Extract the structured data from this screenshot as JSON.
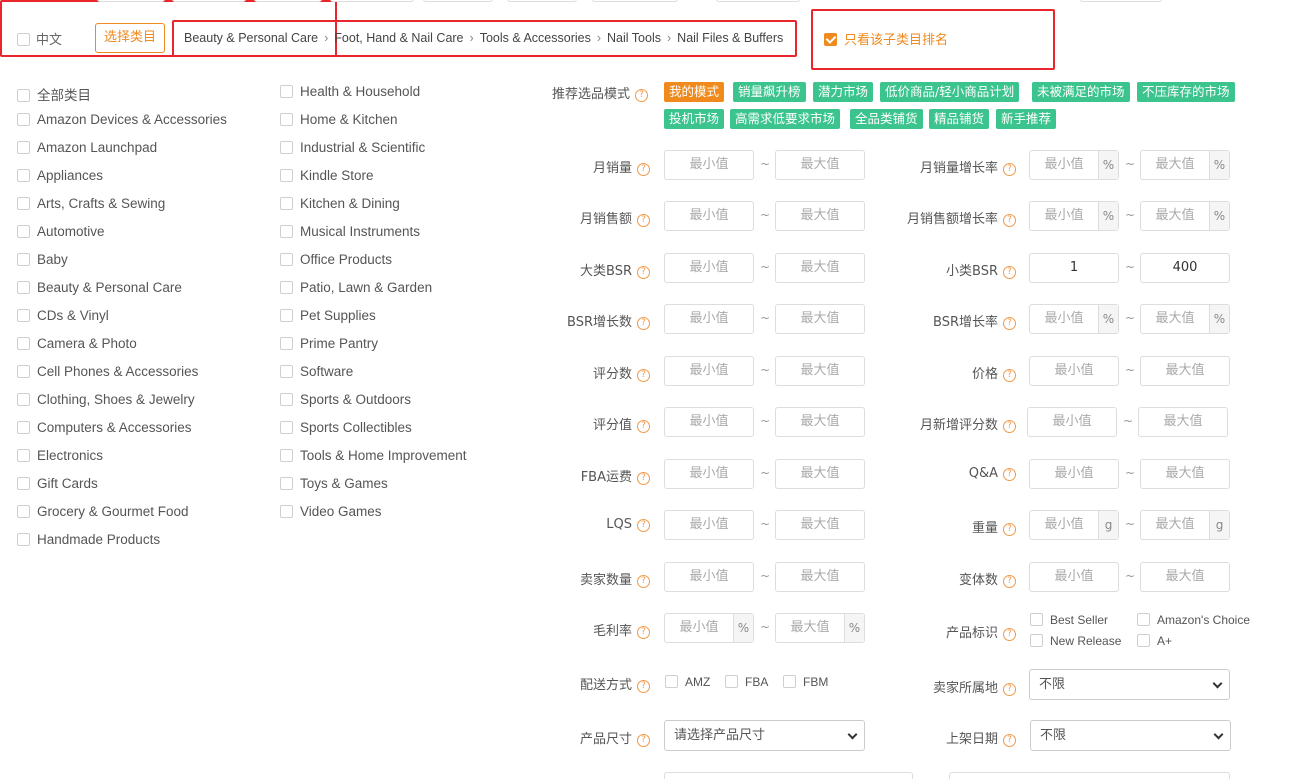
{
  "language": {
    "label": "中文"
  },
  "select_category_button": "选择类目",
  "breadcrumb": [
    "Beauty & Personal Care",
    "Foot, Hand & Nail Care",
    "Tools & Accessories",
    "Nail Tools",
    "Nail Files & Buffers"
  ],
  "subcategory_rank_only": {
    "label": "只看该子类目排名",
    "checked": true
  },
  "categories_left": [
    "全部类目",
    "Amazon Devices & Accessories",
    "Amazon Launchpad",
    "Appliances",
    "Arts, Crafts & Sewing",
    "Automotive",
    "Baby",
    "Beauty & Personal Care",
    "CDs & Vinyl",
    "Camera & Photo",
    "Cell Phones & Accessories",
    "Clothing, Shoes & Jewelry",
    "Computers & Accessories",
    "Electronics",
    "Gift Cards",
    "Grocery & Gourmet Food",
    "Handmade Products"
  ],
  "categories_right": [
    "Health & Household",
    "Home & Kitchen",
    "Industrial & Scientific",
    "Kindle Store",
    "Kitchen & Dining",
    "Musical Instruments",
    "Office Products",
    "Patio, Lawn & Garden",
    "Pet Supplies",
    "Prime Pantry",
    "Software",
    "Sports & Outdoors",
    "Sports Collectibles",
    "Tools & Home Improvement",
    "Toys & Games",
    "Video Games"
  ],
  "mode": {
    "label": "推荐选品模式",
    "tags_row1": [
      "我的模式",
      "销量飙升榜",
      "潜力市场",
      "低价商品/轻小商品计划",
      "未被满足的市场",
      "不压库存的市场"
    ],
    "tags_row2": [
      "投机市场",
      "高需求低要求市场",
      "全品类铺货",
      "精品铺货",
      "新手推荐"
    ],
    "active": "我的模式"
  },
  "placeholders": {
    "min": "最小值",
    "max": "最大值"
  },
  "units": {
    "percent": "%",
    "gram": "g"
  },
  "left_filters": [
    "月销量",
    "月销售额",
    "大类BSR",
    "BSR增长数",
    "评分数",
    "评分值",
    "FBA运费",
    "LQS",
    "卖家数量",
    "毛利率"
  ],
  "right_filters": [
    "月销量增长率",
    "月销售额增长率",
    "小类BSR",
    "BSR增长率",
    "价格",
    "月新增评分数",
    "Q&A",
    "重量",
    "变体数"
  ],
  "sub_bsr": {
    "min": "1",
    "max": "400"
  },
  "product_badge": {
    "label": "产品标识",
    "options": [
      "Best Seller",
      "Amazon's Choice",
      "New Release",
      "A+"
    ]
  },
  "shipping": {
    "label": "配送方式",
    "options": [
      "AMZ",
      "FBA",
      "FBM"
    ]
  },
  "seller_location": {
    "label": "卖家所属地",
    "value": "不限"
  },
  "product_size": {
    "label": "产品尺寸",
    "placeholder": "请选择产品尺寸"
  },
  "listing_date": {
    "label": "上架日期",
    "value": "不限"
  },
  "help_glyph": "?",
  "tilde": "~"
}
